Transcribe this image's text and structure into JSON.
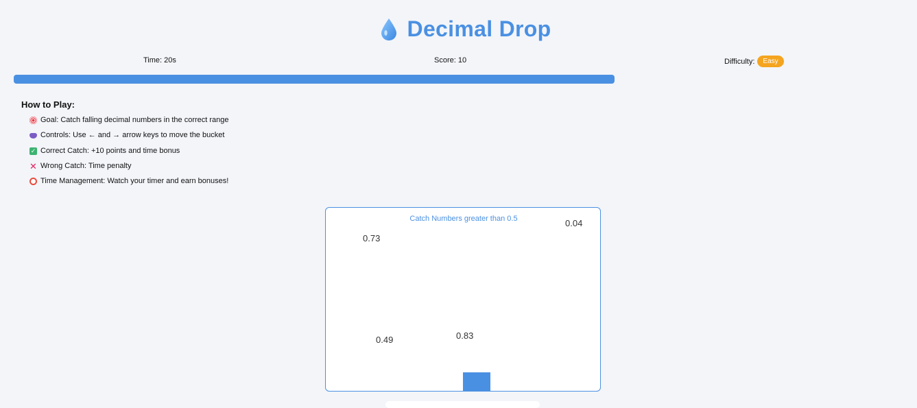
{
  "header": {
    "icon": "water-drop-icon",
    "title": "Decimal Drop"
  },
  "stats": {
    "time": "Time: 20s",
    "score": "Score: 10",
    "difficulty_label": "Difficulty:",
    "difficulty_value": "Easy"
  },
  "timer": {
    "progress_percent": 100
  },
  "how_to_play": {
    "title": "How to Play:",
    "items": [
      {
        "icon": "target-icon",
        "text": "Goal: Catch falling decimal numbers in the correct range"
      },
      {
        "icon": "gamepad-icon",
        "text": "Controls: Use ← and → arrow keys to move the bucket"
      },
      {
        "icon": "checkmark-icon",
        "text": "Correct Catch: +10 points and time bonus"
      },
      {
        "icon": "cross-icon",
        "text": "Wrong Catch: Time penalty"
      },
      {
        "icon": "alarm-clock-icon",
        "text": "Time Management: Watch your timer and earn bonuses!"
      }
    ]
  },
  "game": {
    "instruction": "Catch Numbers greater than 0.5",
    "falling_numbers": [
      "0.73",
      "0.04",
      "0.49",
      "0.83"
    ]
  },
  "colors": {
    "accent": "#4a90e2",
    "badge": "#f5a41f",
    "background": "#f3f5f9"
  }
}
